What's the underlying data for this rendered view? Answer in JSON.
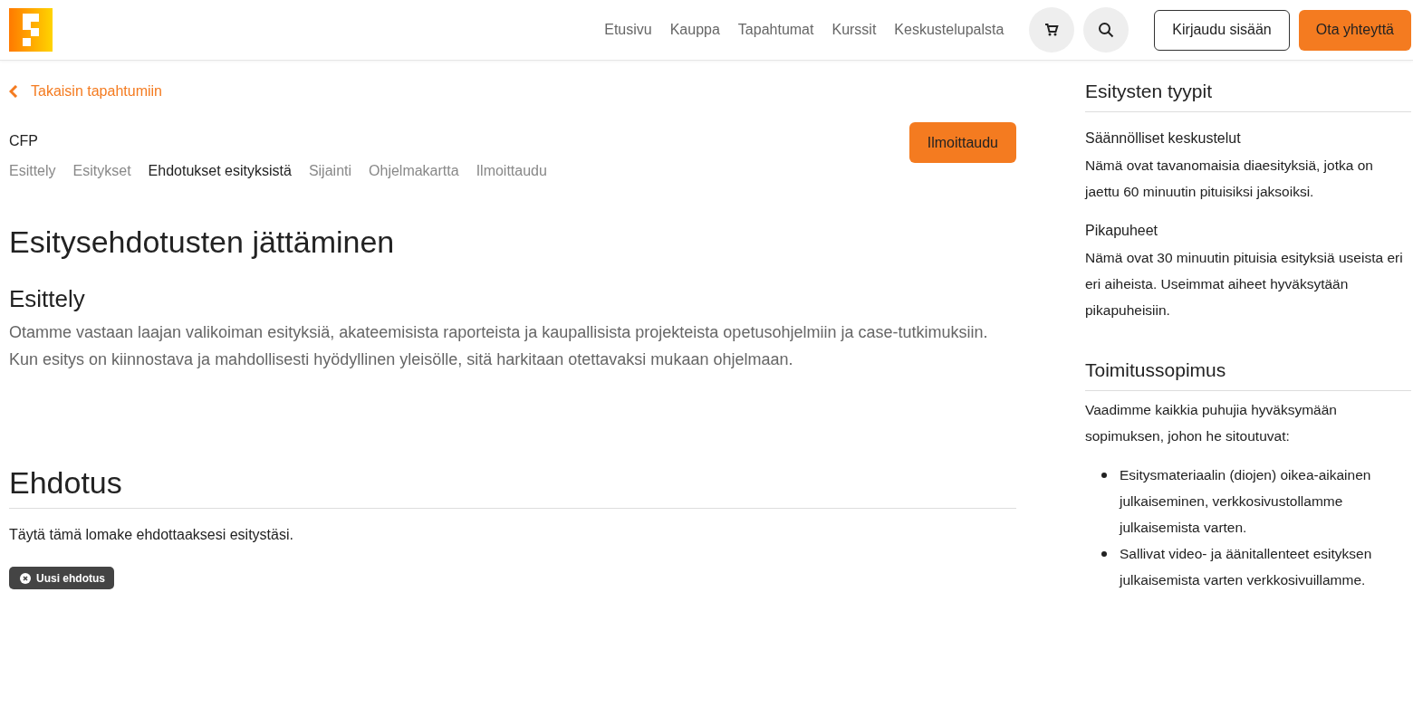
{
  "header": {
    "nav": [
      "Etusivu",
      "Kauppa",
      "Tapahtumat",
      "Kurssit",
      "Keskustelupalsta"
    ],
    "login": "Kirjaudu sisään",
    "contact": "Ota yhteyttä"
  },
  "back_link": "Takaisin tapahtumiin",
  "event": {
    "title": "CFP",
    "register_button": "Ilmoittaudu"
  },
  "tabs": [
    {
      "label": "Esittely",
      "selected": false
    },
    {
      "label": "Esitykset",
      "selected": false
    },
    {
      "label": "Ehdotukset esityksistä",
      "selected": true
    },
    {
      "label": "Sijainti",
      "selected": false
    },
    {
      "label": "Ohjelmakartta",
      "selected": false
    },
    {
      "label": "Ilmoittaudu",
      "selected": false
    }
  ],
  "page_title": "Esitysehdotusten jättäminen",
  "intro": {
    "heading": "Esittely",
    "text": "Otamme vastaan laajan valikoiman esityksiä, akateemisista raporteista ja kaupallisista projekteista opetusohjelmiin ja case-tutkimuksiin. Kun esitys on kiinnostava ja mahdollisesti hyödyllinen yleisölle, sitä harkitaan otettavaksi mukaan ohjelmaan."
  },
  "proposal": {
    "heading": "Ehdotus",
    "text": "Täytä tämä lomake ehdottaaksesi esitystäsi.",
    "button": "Uusi ehdotus"
  },
  "sidebar": {
    "types_heading": "Esitysten tyypit",
    "types": [
      {
        "name": "Säännölliset keskustelut",
        "text": "Nämä ovat tavanomaisia diaesityksiä, jotka on jaettu 60 minuutin pituisiksi jaksoiksi."
      },
      {
        "name": "Pikapuheet",
        "text": "Nämä ovat 30 minuutin pituisia esityksiä useista eri eri aiheista. Useimmat aiheet hyväksytään pikapuheisiin."
      }
    ],
    "agreement_heading": "Toimitussopimus",
    "agreement_text": "Vaadimme kaikkia puhujia hyväksymään sopimuksen, johon he sitoutuvat:",
    "agreement_items": [
      "Esitysmateriaalin (diojen) oikea-aikainen julkaiseminen, verkkosivustollamme julkaisemista varten.",
      "Sallivat video- ja äänitallenteet esityksen julkaisemista varten verkkosivuillamme."
    ]
  }
}
